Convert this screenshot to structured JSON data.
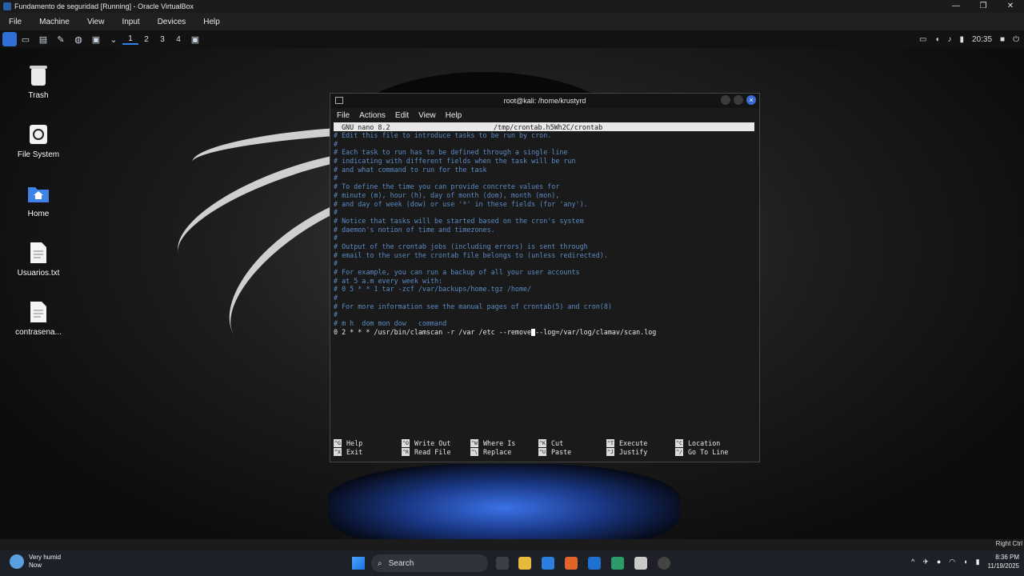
{
  "vbox": {
    "title": "Fundamento de seguridad [Running] - Oracle VirtualBox",
    "menu": [
      "File",
      "Machine",
      "View",
      "Input",
      "Devices",
      "Help"
    ],
    "status_right": "Right Ctrl"
  },
  "kali_panel": {
    "workspaces": [
      "1",
      "2",
      "3",
      "4"
    ],
    "time": "20:35"
  },
  "desktop_icons": [
    {
      "label": "Trash",
      "icon": "trash-icon"
    },
    {
      "label": "File System",
      "icon": "filesystem-icon"
    },
    {
      "label": "Home",
      "icon": "home-folder-icon"
    },
    {
      "label": "Usuarios.txt",
      "icon": "text-file-icon"
    },
    {
      "label": "contrasena...",
      "icon": "text-file-icon"
    }
  ],
  "terminal": {
    "title": "root@kali: /home/krustyrd",
    "menu": [
      "File",
      "Actions",
      "Edit",
      "View",
      "Help"
    ],
    "nano_version": "GNU nano 8.2",
    "file_path": "/tmp/crontab.h5Wh2C/crontab",
    "lines": [
      "# Edit this file to introduce tasks to be run by cron.",
      "#",
      "# Each task to run has to be defined through a single line",
      "# indicating with different fields when the task will be run",
      "# and what command to run for the task",
      "#",
      "# To define the time you can provide concrete values for",
      "# minute (m), hour (h), day of month (dom), month (mon),",
      "# and day of week (dow) or use '*' in these fields (for 'any').",
      "#",
      "# Notice that tasks will be started based on the cron's system",
      "# daemon's notion of time and timezones.",
      "#",
      "# Output of the crontab jobs (including errors) is sent through",
      "# email to the user the crontab file belongs to (unless redirected).",
      "#",
      "# For example, you can run a backup of all your user accounts",
      "# at 5 a.m every week with:",
      "# 0 5 * * 1 tar -zcf /var/backups/home.tgz /home/",
      "#",
      "# For more information see the manual pages of crontab(5) and cron(8)",
      "#",
      "# m h  dom mon dow   command"
    ],
    "active_line_before": "0 2 * * * /usr/bin/clamscan -r /var /etc --remove",
    "active_line_after": "--log=/var/log/clamav/scan.log",
    "shortcuts": [
      {
        "key": "^G",
        "label": "Help"
      },
      {
        "key": "^X",
        "label": "Exit"
      },
      {
        "key": "^O",
        "label": "Write Out"
      },
      {
        "key": "^R",
        "label": "Read File"
      },
      {
        "key": "^W",
        "label": "Where Is"
      },
      {
        "key": "^\\",
        "label": "Replace"
      },
      {
        "key": "^K",
        "label": "Cut"
      },
      {
        "key": "^U",
        "label": "Paste"
      },
      {
        "key": "^T",
        "label": "Execute"
      },
      {
        "key": "^J",
        "label": "Justify"
      },
      {
        "key": "^C",
        "label": "Location"
      },
      {
        "key": "^/",
        "label": "Go To Line"
      }
    ]
  },
  "taskbar": {
    "weather_title": "Very humid",
    "weather_sub": "Now",
    "search_placeholder": "Search",
    "time": "8:36 PM",
    "date": "11/19/2025"
  }
}
